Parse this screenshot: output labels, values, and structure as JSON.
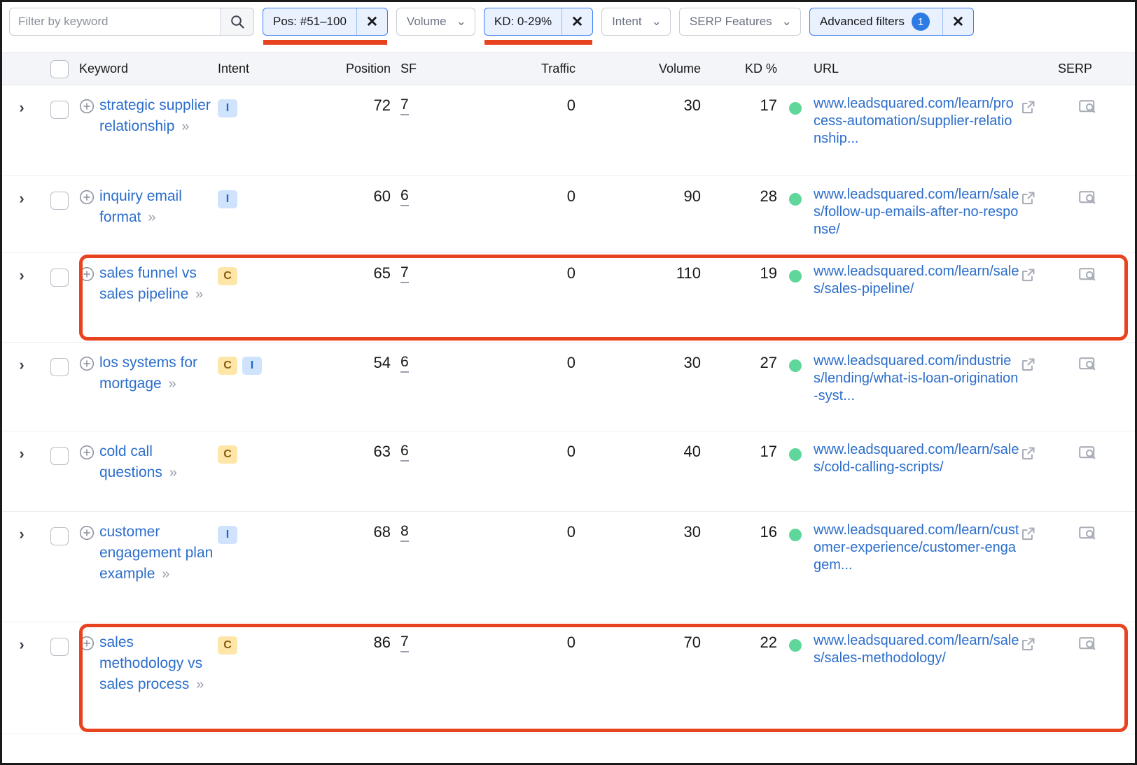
{
  "toolbar": {
    "search": {
      "placeholder": "Filter by keyword",
      "value": "",
      "icon": "search-icon"
    },
    "filters": [
      {
        "label": "Pos: #51–100",
        "active": true,
        "removable": true,
        "underlined": true
      },
      {
        "label": "Volume",
        "active": false,
        "removable": false,
        "underlined": false
      },
      {
        "label": "KD: 0-29%",
        "active": true,
        "removable": true,
        "underlined": true
      },
      {
        "label": "Intent",
        "active": false,
        "removable": false,
        "underlined": false
      },
      {
        "label": "SERP Features",
        "active": false,
        "removable": false,
        "underlined": false
      }
    ],
    "advanced": {
      "label": "Advanced filters",
      "count": "1",
      "close": "×"
    },
    "close_glyph": "✕",
    "caret_glyph": "⌄",
    "highlight_color": "#e8431f",
    "active_chip_color": "#3b7df6"
  },
  "table": {
    "columns": [
      "Keyword",
      "Intent",
      "Position",
      "SF",
      "Traffic",
      "Volume",
      "KD %",
      "URL",
      "SERP"
    ],
    "select_all_checkbox": "",
    "rows": [
      {
        "keyword": "strategic supplier relationship",
        "intent": [
          "I"
        ],
        "position": "72",
        "sf": "7",
        "traffic": "0",
        "volume": "30",
        "kd": "17",
        "kd_color": "#5fd69a",
        "url": "www.leadsquared.com/learn/process-automation/supplier-relationship...",
        "highlighted": false
      },
      {
        "keyword": "inquiry email format",
        "intent": [
          "I"
        ],
        "position": "60",
        "sf": "6",
        "traffic": "0",
        "volume": "90",
        "kd": "28",
        "kd_color": "#5fd69a",
        "url": "www.leadsquared.com/learn/sales/follow-up-emails-after-no-response/",
        "highlighted": false
      },
      {
        "keyword": "sales funnel vs sales pipeline",
        "intent": [
          "C"
        ],
        "position": "65",
        "sf": "7",
        "traffic": "0",
        "volume": "110",
        "kd": "19",
        "kd_color": "#5fd69a",
        "url": "www.leadsquared.com/learn/sales/sales-pipeline/",
        "highlighted": true
      },
      {
        "keyword": "los systems for mortgage",
        "intent": [
          "C",
          "I"
        ],
        "position": "54",
        "sf": "6",
        "traffic": "0",
        "volume": "30",
        "kd": "27",
        "kd_color": "#5fd69a",
        "url": "www.leadsquared.com/industries/lending/what-is-loan-origination-syst...",
        "highlighted": false
      },
      {
        "keyword": "cold call questions",
        "intent": [
          "C"
        ],
        "position": "63",
        "sf": "6",
        "traffic": "0",
        "volume": "40",
        "kd": "17",
        "kd_color": "#5fd69a",
        "url": "www.leadsquared.com/learn/sales/cold-calling-scripts/",
        "highlighted": false
      },
      {
        "keyword": "customer engagement plan example",
        "intent": [
          "I"
        ],
        "position": "68",
        "sf": "8",
        "traffic": "0",
        "volume": "30",
        "kd": "16",
        "kd_color": "#5fd69a",
        "url": "www.leadsquared.com/learn/customer-experience/customer-engagem...",
        "highlighted": false
      },
      {
        "keyword": "sales methodology vs sales process",
        "intent": [
          "C"
        ],
        "position": "86",
        "sf": "7",
        "traffic": "0",
        "volume": "70",
        "kd": "22",
        "kd_color": "#5fd69a",
        "url": "www.leadsquared.com/learn/sales/sales-methodology/",
        "highlighted": true
      }
    ],
    "row_icons": {
      "expand": "chevron-right-icon",
      "add": "plus-circle-icon",
      "more": "double-chevron-icon",
      "external": "external-link-icon",
      "serp": "serp-preview-icon"
    },
    "more_glyph": "»"
  }
}
